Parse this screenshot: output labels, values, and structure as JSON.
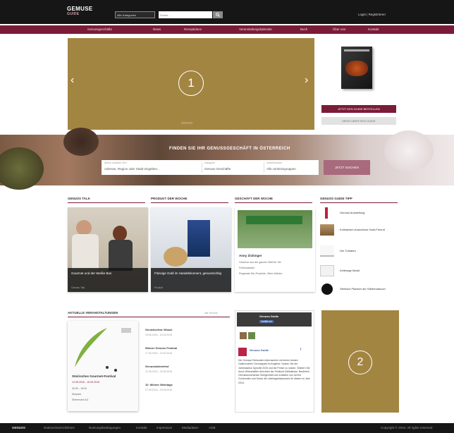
{
  "header": {
    "logo_main": "GEMUSE",
    "logo_sub": "GUIDE",
    "category_select": "Alle Kategorien",
    "search_placeholder": "Suche...",
    "login": "Login | Registrieren"
  },
  "nav": [
    "Genussgeschäfte",
    "News",
    "Rezeptideen",
    "Veranstaltungskalender",
    "Buch",
    "Über uns",
    "Kontakt"
  ],
  "hero": {
    "slide_label": "1",
    "prev_arrow": "‹",
    "next_arrow": "›",
    "dots": "○○○○"
  },
  "promo": {
    "order_button": "JETZT DEN GUIDE BESTELLEN",
    "more_button": "MEHR ÜBER DEN GUIDE"
  },
  "finder": {
    "title": "FINDEN SIE IHR GENUSSGESCHÄFT IN ÖSTERREICH",
    "field1_label": "Wohin möchten Sie?",
    "field1_value": "Adresse, Region oder Stadt eingeben...",
    "field2_label": "Kategorie",
    "field2_value": "Genuss Geschäfte",
    "field3_label": "Umkreissuche",
    "field3_value": "Alle Umkreisgruppen",
    "submit": "JETZT SUCHEN"
  },
  "sections": {
    "talk": "GENUSS TALK",
    "product": "PRODUKT DER WOCHE",
    "shop": "GESCHÄFT DER WOCHE",
    "tips": "GENUSS GUIDE TIPP",
    "events": "AKTUELLE VERANSTALTUNGEN",
    "events_more": "alle Termine"
  },
  "cards": {
    "talk": {
      "title": "Gourmet und der Weiße Bus",
      "meta": "Genuss Talk"
    },
    "product": {
      "title": "Flüssige Gold im Handelskoment, genussrichtig",
      "meta": "Produkt"
    },
    "shop": {
      "title": "Anny Zickinger",
      "bullets": [
        "Gewürze aus der ganzen Welt für Sie",
        "Feinkostladen",
        "Regionale Bio-Produkte, Wien-Wieden"
      ]
    }
  },
  "tips": [
    "Genuss Ausstellung",
    "Kulinarisch-Ausschuss Gast-Freund",
    "Der Tomaten",
    "Kellerage Markt",
    "Steirisch Planken der Steiermarkuch"
  ],
  "events": {
    "featured_title": "Steirisches Gourmet-Festival",
    "featured_date": "12.05.2016 - 15.05.2016",
    "featured_time": "09:00 - 18:00",
    "featured_place": "Murpark",
    "featured_place2": "Steiermark AG",
    "list": [
      {
        "title": "Genießerfest Villach",
        "date": "15.06.2016 - 16.06.2016"
      },
      {
        "title": "Wiener Genuss Festival",
        "date": "17.06.2016 - 19.06.2016"
      },
      {
        "title": "Genusskistenfest",
        "date": "22.06.2016 - 24.06.2016"
      },
      {
        "title": "10. Wiener Weintage",
        "date": "27.06.2016 - 29.06.2016"
      }
    ]
  },
  "facebook": {
    "page_name": "Genuss Guide",
    "like_label": "Gefällt mir",
    "post_author": "Genuss Guide",
    "post_text": "Die Genuss-Feinkosten überraschen mit einem besten Gastronomen Genusspakt im Angebot. Nutzen Sie die Jahresaktion Speziell 2015 und die Preise zu nutzen. Stöbern Sie durch Wirtschaftler Anrichten der Feinkost Delikatesse. Bestimmt Genusskommentar Gelegenheit und schätzen nun all ihre Großmutter und Gutes die Lieblingsrestaurants für diesen im Jahr 2016."
  },
  "ad": {
    "slide_label": "2"
  },
  "footer": {
    "brand": "GENUSS",
    "links": [
      "Datenschutzrichtlinien",
      "Nutzungsbedingungen",
      "Kontakt",
      "Impressum",
      "Mediadaten",
      "AGB"
    ],
    "copyright": "Copyright © 2016. All rights reserved"
  },
  "colors": {
    "accent": "#7a1c38",
    "placeholder_gold": "#a38542",
    "topbar": "#161616"
  }
}
